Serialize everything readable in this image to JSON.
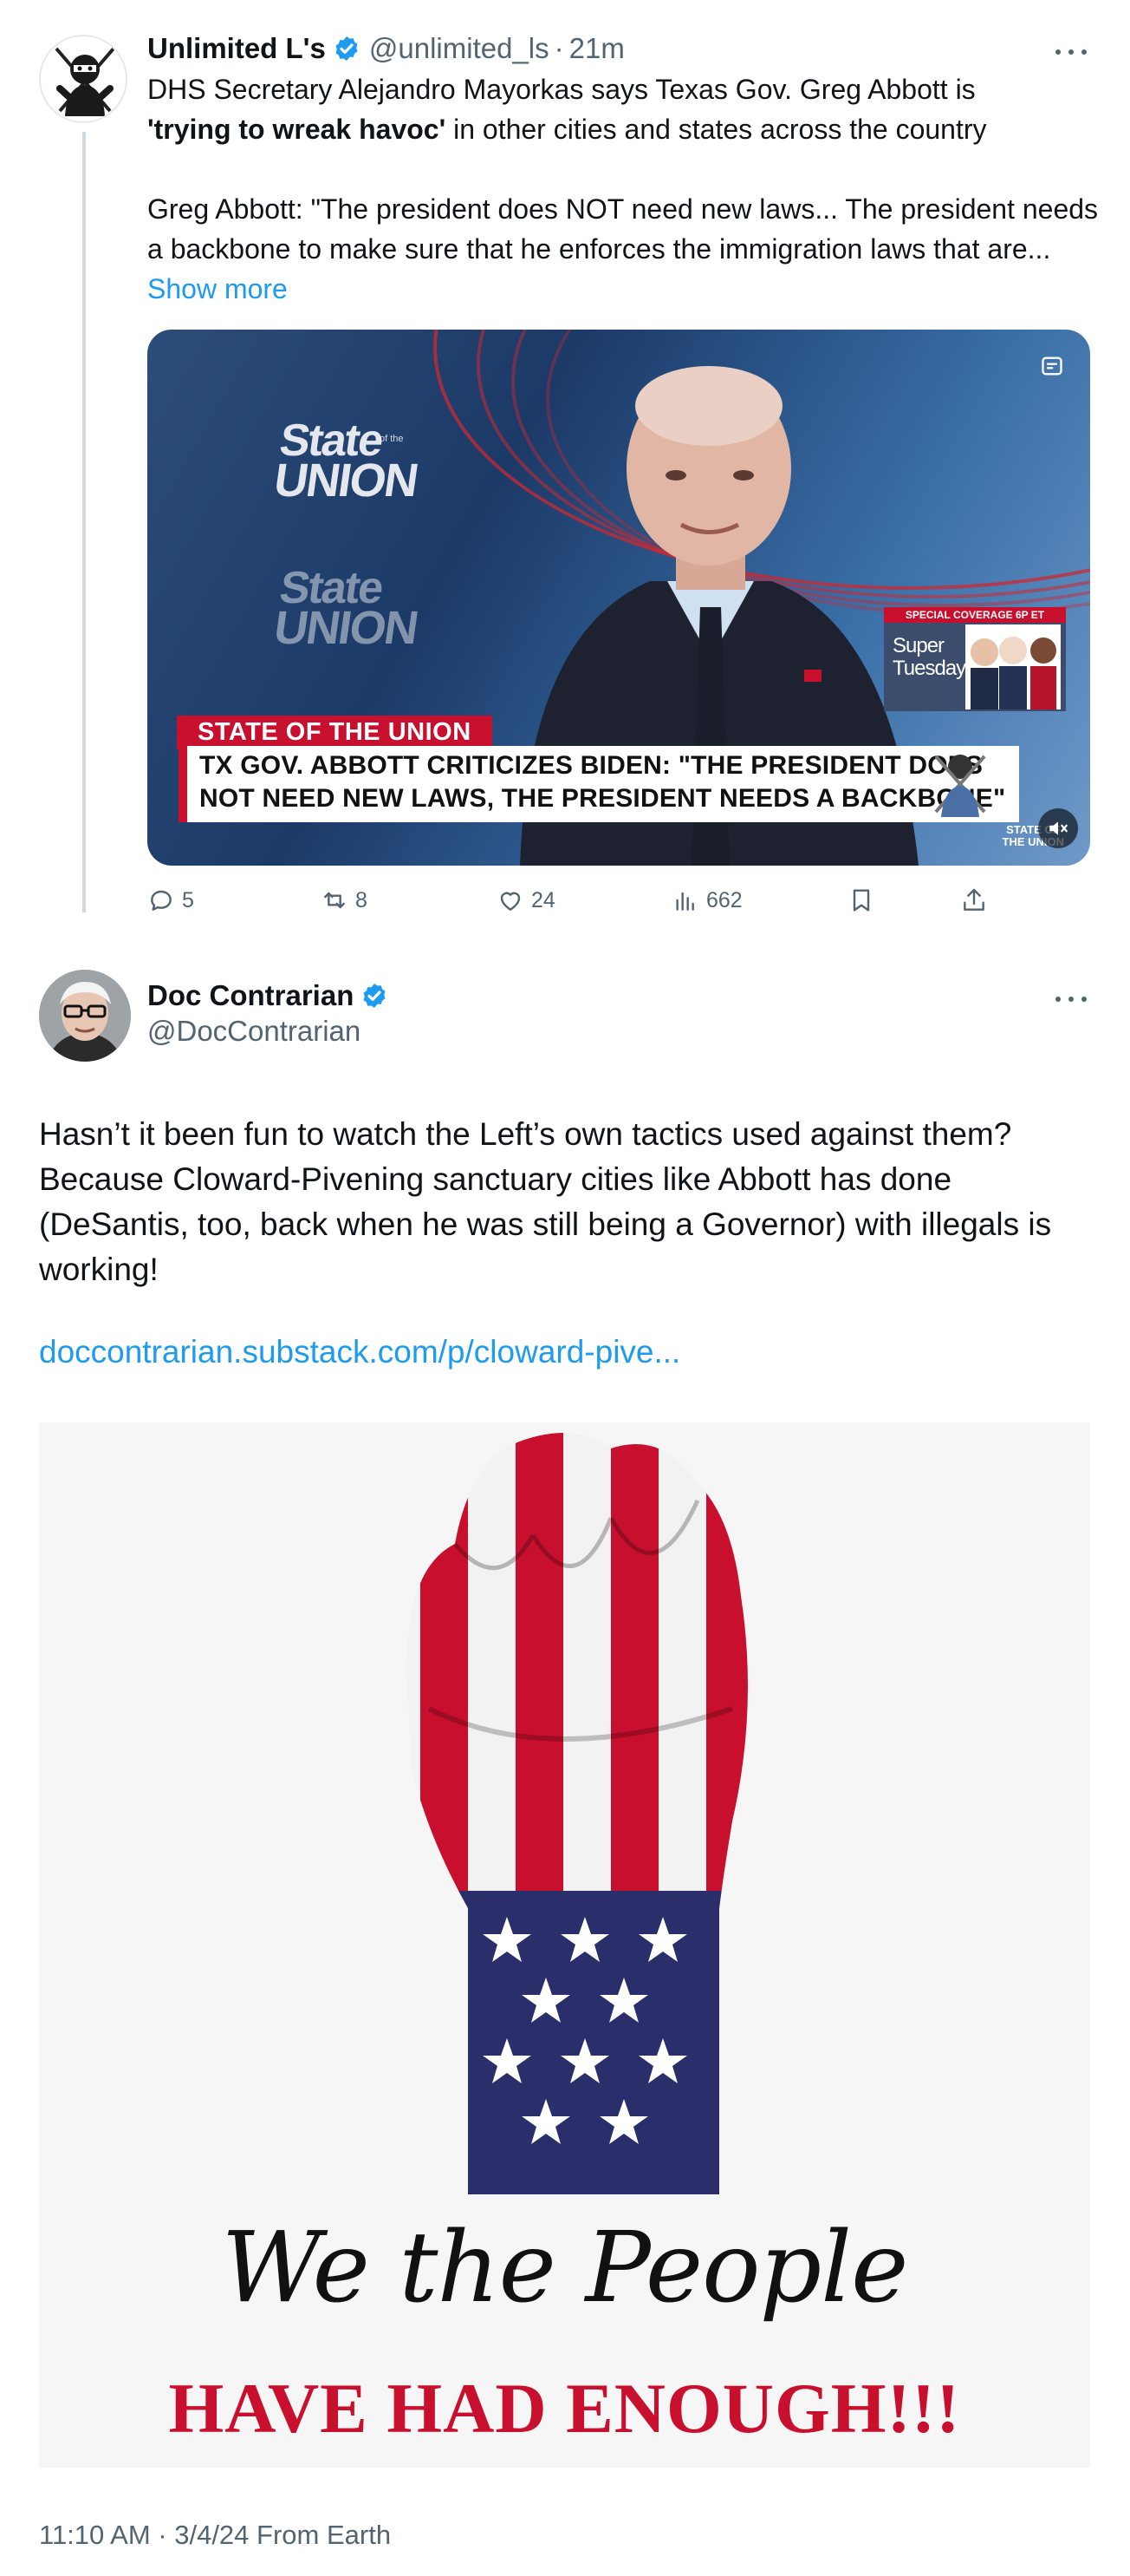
{
  "tweet1": {
    "author_name": "Unlimited L's",
    "handle": "@unlimited_ls",
    "separator": "·",
    "time": "21m",
    "text_line1_prefix": "DHS Secretary Alejandro Mayorkas says Texas Gov. Greg Abbott is",
    "text_line2_bold": "'trying to wreak havoc'",
    "text_line2_rest": " in other cities and states across the country",
    "text_para2": "Greg Abbott: \"The president does NOT need new laws... The president needs a backbone to make sure that he enforces the immigration laws that are...",
    "show_more": "Show more",
    "video": {
      "logo_line1": "State",
      "logo_sub": "of the",
      "logo_line2": "UNION",
      "logo_line3": "State",
      "logo_line4": "UNION",
      "lower_third_tag": "STATE OF THE UNION",
      "headline_line1": "TX GOV. ABBOTT CRITICIZES BIDEN: \"THE PRESIDENT DOES",
      "headline_line2": "NOT NEED NEW LAWS, THE PRESIDENT NEEDS A BACKBONE\"",
      "special_head": "SPECIAL COVERAGE 6P ET",
      "special_line1": "Super",
      "special_line2": "Tuesday",
      "brand_line1": "STATE OF",
      "brand_line2": "THE UNION"
    },
    "actions": {
      "replies": "5",
      "reposts": "8",
      "likes": "24",
      "views": "662"
    }
  },
  "tweet2": {
    "author_name": "Doc Contrarian",
    "handle": "@DocContrarian",
    "text": "Hasn’t it been fun to watch the Left’s own tactics used against them? Because Cloward-Pivening sanctuary cities like Abbott has done (DeSantis, too, back when he was still being a Governor) with illegals is working!",
    "link": "doccontrarian.substack.com/p/cloward-pive...",
    "poster_script": "We the People",
    "poster_banner": "HAVE HAD ENOUGH!!!",
    "timestamp": "11:10 AM · 3/4/24 From Earth"
  },
  "colors": {
    "accent": "#1d9bf0",
    "secondary_text": "#536471",
    "primary_text": "#0f1419",
    "flag_red": "#c8102e",
    "flag_blue": "#2a2f6b"
  }
}
